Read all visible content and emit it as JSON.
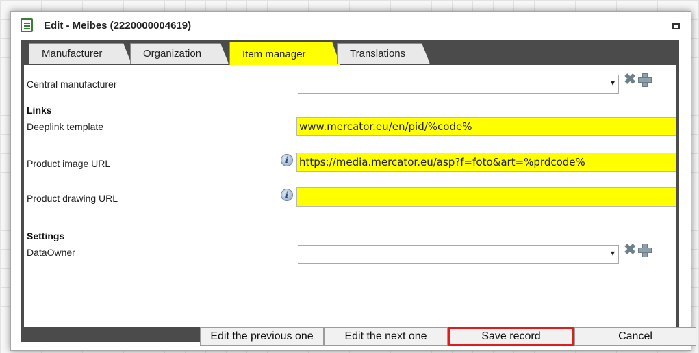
{
  "dialog": {
    "title": "Edit - Meibes (2220000004619)",
    "tabs": [
      {
        "label": "Manufacturer",
        "active": false
      },
      {
        "label": "Organization",
        "active": false
      },
      {
        "label": "Item manager",
        "active": true
      },
      {
        "label": "Translations",
        "active": false
      }
    ]
  },
  "form": {
    "central_manufacturer_label": "Central manufacturer",
    "central_manufacturer_value": "",
    "links_heading": "Links",
    "deeplink_label": "Deeplink template",
    "deeplink_value": "www.mercator.eu/en/pid/%code%",
    "product_image_label": "Product image URL",
    "product_image_value": "https://media.mercator.eu/asp?f=foto&art=%prdcode%",
    "product_drawing_label": "Product drawing URL",
    "product_drawing_value": "",
    "settings_heading": "Settings",
    "dataowner_label": "DataOwner",
    "dataowner_value": ""
  },
  "footer": {
    "prev_label": "Edit the previous one",
    "next_label": "Edit the next one",
    "save_label": "Save record",
    "cancel_label": "Cancel"
  },
  "colors": {
    "highlight": "#ffff00",
    "frame": "#4b4b4b",
    "save_outline": "#e21b1b"
  },
  "icons": {
    "dropdown": "▾",
    "info": "i",
    "clear": "✖",
    "add": "plus"
  }
}
